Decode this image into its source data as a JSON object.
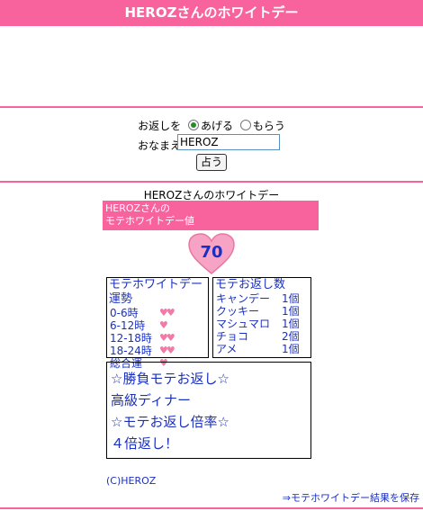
{
  "header": {
    "title": "HEROZさんのホワイトデー"
  },
  "form": {
    "return_label": "お返しを",
    "option_give": "あげる",
    "option_receive": "もらう",
    "selected": "あげる",
    "name_label": "おなまえ",
    "name_value": "HEROZ",
    "submit_label": "占う"
  },
  "result": {
    "title": "HEROZさんのホワイトデー",
    "pink_line1": "HEROZさんの",
    "pink_line2": "モテホワイトデー値",
    "score": "70",
    "luck": {
      "title": "モテホワイトデー運勢",
      "rows": [
        {
          "label": "0-6時",
          "hearts": "♥♥"
        },
        {
          "label": "6-12時",
          "hearts": "♥"
        },
        {
          "label": "12-18時",
          "hearts": "♥♥"
        },
        {
          "label": "18-24時",
          "hearts": "♥♥"
        },
        {
          "label": "総合運",
          "hearts": "♥"
        }
      ]
    },
    "gifts": {
      "title": "モテお返し数",
      "rows": [
        {
          "name": "キャンデー",
          "qty": "1個"
        },
        {
          "name": "クッキー",
          "qty": "1個"
        },
        {
          "name": "マシュマロ",
          "qty": "1個"
        },
        {
          "name": "チョコ",
          "qty": "2個"
        },
        {
          "name": "アメ",
          "qty": "1個"
        }
      ]
    },
    "big": {
      "line1": "☆勝負モテお返し☆",
      "line2": "高級ディナー",
      "line3": "☆モテお返し倍率☆",
      "line4": "４倍返し！"
    },
    "copyright": "(C)HEROZ",
    "save_link": "⇒モテホワイトデー結果を保存"
  },
  "colors": {
    "accent": "#f8639e",
    "text_blue": "#1a30c0",
    "heart_pink": "#f07aa8"
  }
}
